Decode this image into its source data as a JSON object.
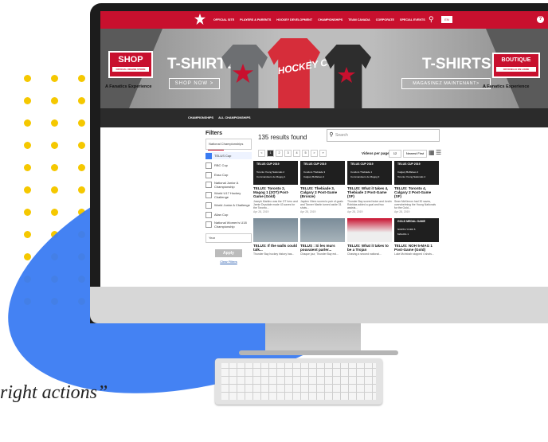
{
  "topnav": {
    "items": [
      "OFFICIAL SITE",
      "PLAYERS & PARENTS",
      "HOCKEY DEVELOPMENT",
      "CHAMPIONSHIPS",
      "TEAM CANADA",
      "CORPORATE",
      "SPECIAL EVENTS"
    ],
    "lang": "EN",
    "help": "?"
  },
  "banner": {
    "shop_badge": "SHOP",
    "shop_badge_sub": "OFFICIAL ONLINE STORE",
    "fanatics_left": "A Fanatics Experience",
    "title_en": "T-SHIRTS",
    "cta_en": "SHOP NOW >",
    "shirt_text": "HOCKEY CANADA",
    "title_fr": "T-SHIRTS",
    "cta_fr": "MAGASINEZ MAINTENANT>",
    "boutique_badge": "BOUTIQUE",
    "boutique_badge_sub": "OFFICIELLE EN LIGNE",
    "fanatics_right": "A Fanatics Experience"
  },
  "subbar": {
    "items": [
      "CHAMPIONSHIPS",
      "ALL CHAMPIONSHIPS"
    ]
  },
  "filters": {
    "title": "Filters",
    "group": "National Championships",
    "items": [
      {
        "label": "TELUS Cup",
        "checked": true
      },
      {
        "label": "RBC Cup",
        "checked": false
      },
      {
        "label": "Esso Cup",
        "checked": false
      },
      {
        "label": "National Junior A Championship",
        "checked": false
      },
      {
        "label": "World U17 Hockey Challenge",
        "checked": false
      },
      {
        "label": "World Junior A Challenge",
        "checked": false
      },
      {
        "label": "Allan Cup",
        "checked": false
      },
      {
        "label": "National Women's U18 Championship",
        "checked": false
      }
    ],
    "year_label": "Year",
    "apply": "Apply",
    "clear": "Clear Filters"
  },
  "results": {
    "count_text": "135 results found",
    "search_placeholder": "Search",
    "pages": [
      "<",
      "1",
      "2",
      "3",
      "4",
      "5",
      ">",
      "»"
    ],
    "per_page_label": "Videos per page",
    "per_page_value": "12",
    "sort_value": "Newest First"
  },
  "cards": [
    {
      "title": "TELUS: Toronto 2, Magog 1 (2OT) Post-Game (Gold)",
      "desc": "Joseph Martino was the OT hero and Jamie Drysdale made 43 saves for the Toronto...",
      "date": "Apr 28, 2019",
      "thumb_label": "TELUS CUP 2019",
      "rows": [
        "Toronto Young Nationals 2",
        "Commandeurs de Magog 1"
      ]
    },
    {
      "title": "TELUS: Thebiade 3, Calgary 2 Post-Game (Bronze)",
      "desc": "Jayden Vliers scored a pair of goals and Tanner Martin turned aside 31 shots...",
      "date": "Apr 28, 2019",
      "thumb_label": "TELUS CUP 2019",
      "rows": [
        "Condors Thebiade 3",
        "Calgary Buffaloes 2"
      ]
    },
    {
      "title": "TELUS: What it takes to a ...",
      "desc": "",
      "date": "",
      "thumb_label": "TELUS CUP 2019",
      "rows": [
        "Condors Thebiade 1",
        "Commandeurs de Magog 3"
      ]
    },
    {
      "title": "TELUS: Toronto 4, Calgary 2 Post-Game (SF)",
      "desc": "Sean McKinnon had 30 saves, overwhelming the Young Nationals for the Gold...",
      "date": "Apr 28, 2019",
      "thumb_label": "TELUS CUP 2019",
      "rows": [
        "Calgary Buffaloes 2",
        "Toronto Young Nationals 4"
      ]
    },
    {
      "title": "TELUS: If the walls could talk...",
      "desc": "Thunder Bay hockey history has...",
      "date": "",
      "thumb_label": "",
      "rows": []
    },
    {
      "title": "TELUS : Si les murs pouvaient parler...",
      "desc": "Chaque jour, Thunder Bay est...",
      "date": "",
      "thumb_label": "",
      "rows": []
    },
    {
      "title": "TELUS: What it takes to be a Trojan",
      "desc": "Chasing a second national...",
      "date": "",
      "thumb_label": "",
      "rows": []
    },
    {
      "title": "TELUS: NOH 5-MAG 1 Post-Game (Gold)",
      "desc": "Luke McIntosh stopped 4 shots...",
      "date": "",
      "thumb_label": "GOLD MEDAL GAME",
      "rows": [
        "NORTH YORK 5",
        "MAGOG 1"
      ]
    }
  ],
  "card3_override": {
    "title": "TELUS: What it takes 4, Thebiade 2 Post-Game (SF)",
    "desc": "Thunder Bay scored twice and Justin Robidas added a goal and two assists...",
    "date": "Apr 28, 2019"
  },
  "tagline": "right actions”",
  "colors": {
    "accent_red": "#c8102e",
    "brand_yellow": "#f5c800",
    "brand_blue": "#3a7bf2"
  }
}
